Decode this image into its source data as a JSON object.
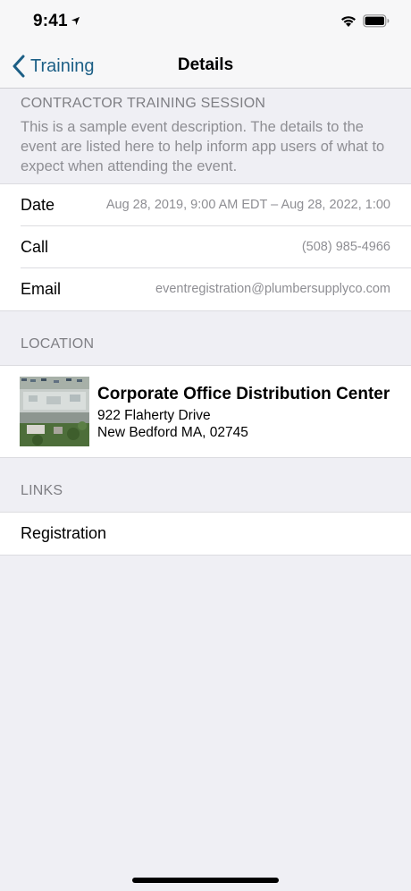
{
  "status_bar": {
    "time": "9:41",
    "icons": [
      "location-arrow-icon",
      "wifi-icon",
      "battery-icon"
    ]
  },
  "nav": {
    "back_label": "Training",
    "title": "Details",
    "accent_color": "#1c5f86"
  },
  "event": {
    "title": "CONTRACTOR TRAINING SESSION",
    "description": "This is a sample event description. The details to the event are listed here to help inform app users of what to expect when attending the event."
  },
  "info": {
    "date_label": "Date",
    "date_value": "Aug 28, 2019, 9:00 AM EDT – Aug 28, 2022, 1:00",
    "call_label": "Call",
    "call_value": "(508) 985-4966",
    "email_label": "Email",
    "email_value": "eventregistration@plumbersupplyco.com"
  },
  "location": {
    "header": "LOCATION",
    "name": "Corporate Office Distribution Center",
    "address_line1": "922 Flaherty Drive",
    "address_line2": "New Bedford MA, 02745"
  },
  "links": {
    "header": "LINKS",
    "registration_label": "Registration"
  }
}
